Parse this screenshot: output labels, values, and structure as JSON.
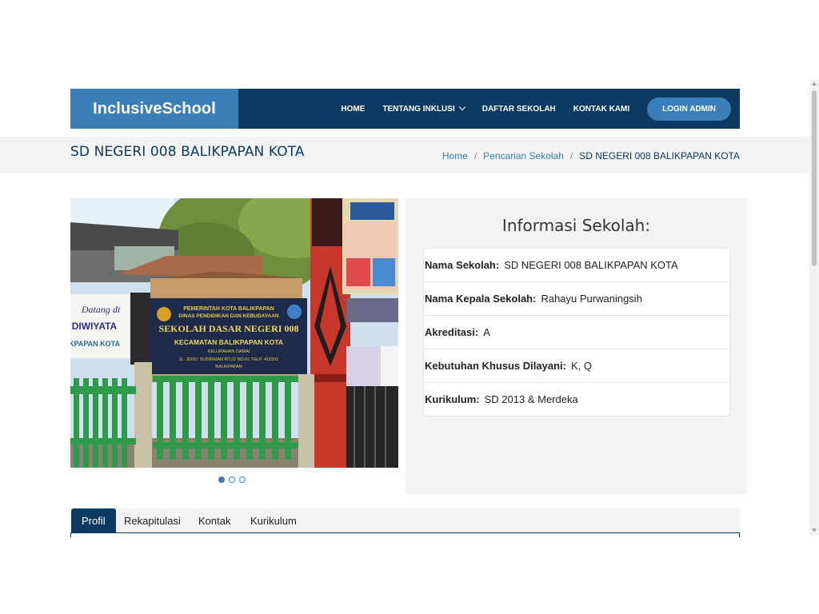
{
  "header": {
    "brand": "InclusiveSchool",
    "nav": [
      "HOME",
      "TENTANG INKLUSI",
      "DAFTAR SEKOLAH",
      "KONTAK KAMI"
    ],
    "login": "LOGIN ADMIN"
  },
  "page": {
    "title": "SD NEGERI 008 BALIKPAPAN KOTA",
    "breadcrumb": {
      "home": "Home",
      "search": "Pencarian Sekolah",
      "current": "SD NEGERI 008 BALIKPAPAN KOTA",
      "separator": "/"
    }
  },
  "photo": {
    "sign_lines": [
      "PEMERINTAH KOTA BALIKPAPAN",
      "DINAS PENDIDIKAN DAN KEBUDAYAAN",
      "SEKOLAH DASAR NEGERI 008",
      "KECAMATAN BALIKPAPAN KOTA",
      "KELURAHAN DAMAI",
      "JL. JEND. SUDIRMAN RT.22 NO.61 TELP. 410201",
      "BALIKPAPAN"
    ],
    "banner_lines": [
      "Datang di",
      "DIWIYATA",
      "KPAPAN KOTA"
    ]
  },
  "carousel": {
    "slides": 3,
    "active": 0
  },
  "info": {
    "heading": "Informasi Sekolah:",
    "rows": [
      {
        "label": "Nama Sekolah:",
        "value": "SD NEGERI 008 BALIKPAPAN KOTA"
      },
      {
        "label": "Nama Kepala Sekolah:",
        "value": "Rahayu Purwaningsih"
      },
      {
        "label": "Akreditasi:",
        "value": "A"
      },
      {
        "label": "Kebutuhan Khusus Dilayani:",
        "value": "K, Q"
      },
      {
        "label": "Kurikulum:",
        "value": "SD 2013 & Merdeka"
      }
    ]
  },
  "tabs": [
    "Profil",
    "Rekapitulasi",
    "Kontak",
    "Kurikulum"
  ],
  "colors": {
    "navy": "#0b3a63",
    "accent": "#3a7fb9",
    "panel": "#f3f3f3"
  }
}
